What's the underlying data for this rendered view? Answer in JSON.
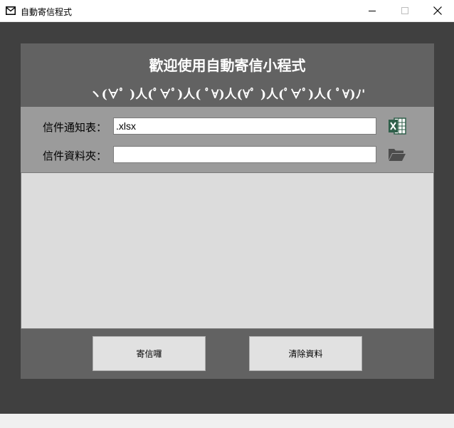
{
  "window": {
    "title": "自動寄信程式",
    "icon": "mail-icon"
  },
  "header": {
    "title": "歡迎使用自動寄信小程式",
    "kaomoji": "ヽ(∀ﾟ )人(ﾟ∀ﾟ)人( ﾟ∀)人(∀ﾟ )人(ﾟ∀ﾟ)人( ﾟ∀)ﾉ'"
  },
  "form": {
    "notice_label": "信件通知表：",
    "notice_value": ".xlsx",
    "notice_icon": "excel-icon",
    "folder_label": "信件資料夾：",
    "folder_value": "",
    "folder_icon": "folder-open-icon"
  },
  "buttons": {
    "send_label": "寄信囉",
    "clear_label": "清除資料"
  },
  "colors": {
    "background": "#404040",
    "panel": "#626262",
    "form_band": "#9b9b9b",
    "log_area": "#dcdcdc",
    "button": "#e1e1e1",
    "excel_green": "#2f5f4a"
  }
}
